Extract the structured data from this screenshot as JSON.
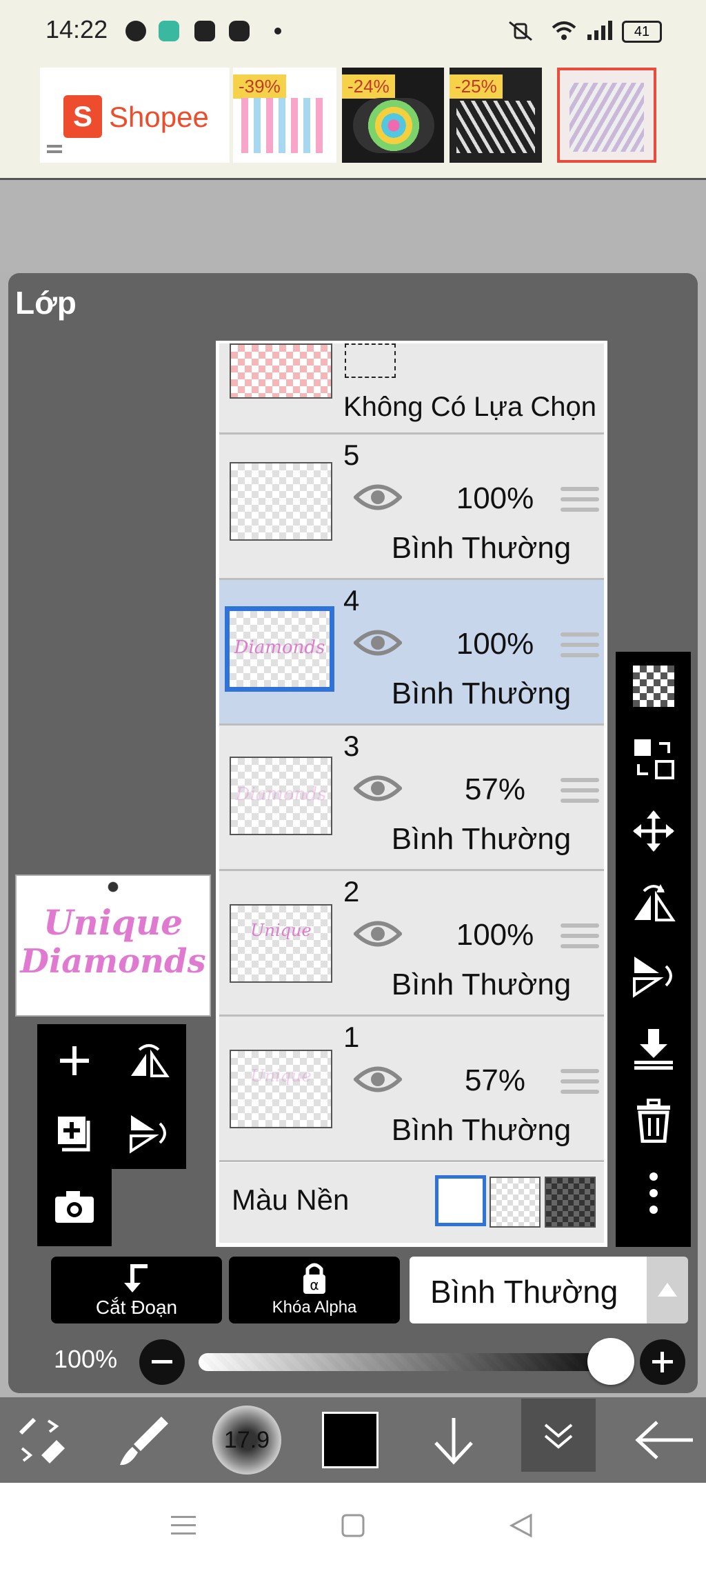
{
  "status_bar": {
    "time": "14:22",
    "battery": "41"
  },
  "ad": {
    "brand": "Shopee",
    "discounts": [
      "-39%",
      "-24%",
      "-25%"
    ]
  },
  "panel": {
    "title": "Lớp"
  },
  "selection_row": {
    "label": "Không Có Lựa Chọn"
  },
  "layers": [
    {
      "number": "5",
      "opacity": "100%",
      "blend": "Bình Thường",
      "selected": false,
      "thumb_text": ""
    },
    {
      "number": "4",
      "opacity": "100%",
      "blend": "Bình Thường",
      "selected": true,
      "thumb_text": "Diamonds"
    },
    {
      "number": "3",
      "opacity": "57%",
      "blend": "Bình Thường",
      "selected": false,
      "thumb_text": "Diamonds"
    },
    {
      "number": "2",
      "opacity": "100%",
      "blend": "Bình Thường",
      "selected": false,
      "thumb_text": "Unique"
    },
    {
      "number": "1",
      "opacity": "57%",
      "blend": "Bình Thường",
      "selected": false,
      "thumb_text": "Unique"
    }
  ],
  "background_row": {
    "label": "Màu Nền"
  },
  "preview": {
    "line1": "Unique",
    "line2": "Diamonds"
  },
  "bottom_controls": {
    "clip_label": "Cắt Đoạn",
    "alpha_lock_label": "Khóa Alpha",
    "blend_mode": "Bình Thường",
    "opacity_label": "100%",
    "opacity_value": 1.0
  },
  "toolbar": {
    "brush_size": "17.9"
  },
  "colors": {
    "selected_row": "#c8d6ec",
    "selection_border": "#2f72d8",
    "accent_shopee": "#ee4d2d"
  }
}
